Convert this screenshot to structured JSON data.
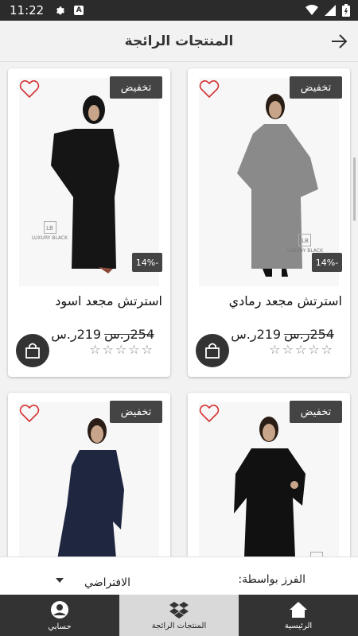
{
  "status": {
    "time": "11:22",
    "launcher_letter": "A"
  },
  "header": {
    "title": "المنتجات الرائجة"
  },
  "products": [
    {
      "name": "استرتش مجعد رمادي",
      "sale_badge": "تخفيض",
      "discount": "14%-",
      "old_price": "254ر.س",
      "price": "219ر.س",
      "garment_color": "#8a8a8a",
      "logo": "LUXURY BLACK"
    },
    {
      "name": "استرتش مجعد اسود",
      "sale_badge": "تخفيض",
      "discount": "14%-",
      "old_price": "254ر.س",
      "price": "219ر.س",
      "garment_color": "#151515",
      "logo": "LUXURY BLACK"
    },
    {
      "name": "",
      "sale_badge": "تخفيض",
      "garment_color": "#111111",
      "logo": "LB"
    },
    {
      "name": "",
      "sale_badge": "تخفيض",
      "garment_color": "#1f2640",
      "logo": ""
    }
  ],
  "sort": {
    "label": "الفرز بواسطة:",
    "value": "الافتراضي"
  },
  "nav": [
    {
      "label": "الرئيسية",
      "icon": "home-icon"
    },
    {
      "label": "المنتجات الرائجة",
      "icon": "dropbox-icon"
    },
    {
      "label": "حسابي",
      "icon": "user-icon"
    }
  ],
  "colors": {
    "dark": "#333333",
    "badge": "#444444",
    "heart": "#d32f2f",
    "active_tab": "#d9d9d9"
  }
}
